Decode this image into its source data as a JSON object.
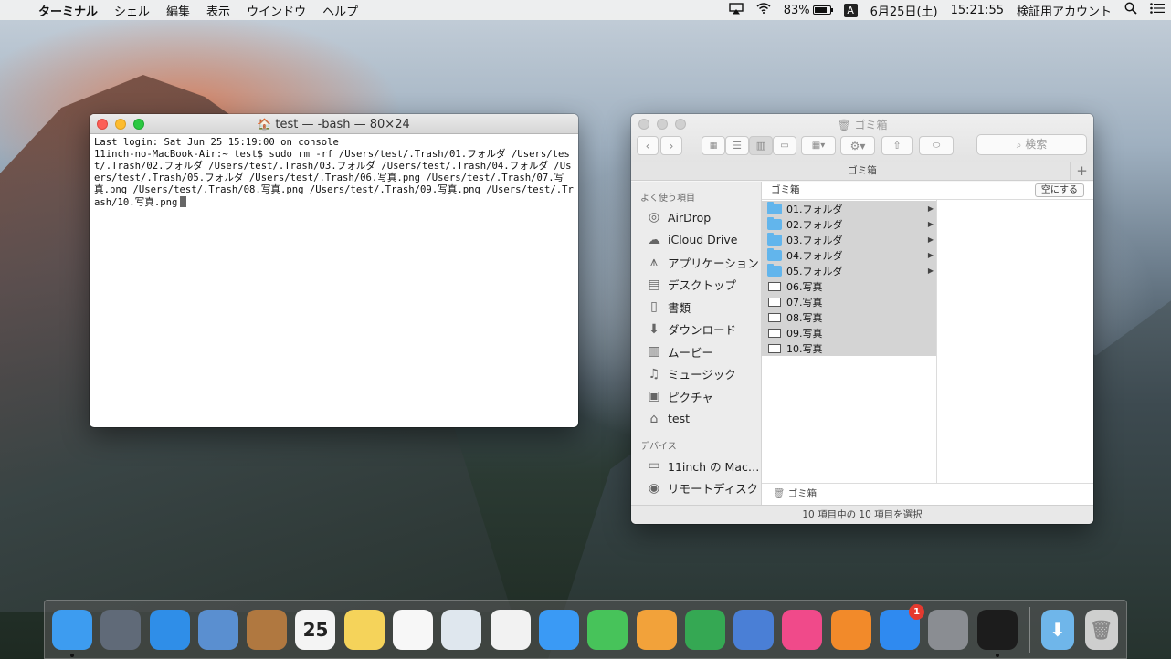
{
  "menubar": {
    "apple": "",
    "app_name": "ターミナル",
    "items": [
      "シェル",
      "編集",
      "表示",
      "ウインドウ",
      "ヘルプ"
    ],
    "battery": "83%",
    "battery_level": 0.83,
    "ime": "A",
    "date": "6月25日(土)",
    "time": "15:21:55",
    "user": "検証用アカウント"
  },
  "terminal": {
    "title": "test — -bash — 80×24",
    "content": "Last login: Sat Jun 25 15:19:00 on console\n11inch-no-MacBook-Air:~ test$ sudo rm -rf /Users/test/.Trash/01.フォルダ /Users/test/.Trash/02.フォルダ /Users/test/.Trash/03.フォルダ /Users/test/.Trash/04.フォルダ /Users/test/.Trash/05.フォルダ /Users/test/.Trash/06.写真.png /Users/test/.Trash/07.写真.png /Users/test/.Trash/08.写真.png /Users/test/.Trash/09.写真.png /Users/test/.Trash/10.写真.png"
  },
  "finder": {
    "title": "ゴミ箱",
    "search_placeholder": "検索",
    "path_tab": "ゴミ箱",
    "favorites_header": "よく使う項目",
    "favorites": [
      {
        "label": "AirDrop",
        "icon": "airdrop-icon"
      },
      {
        "label": "iCloud Drive",
        "icon": "cloud-icon"
      },
      {
        "label": "アプリケーション",
        "icon": "applications-icon"
      },
      {
        "label": "デスクトップ",
        "icon": "desktop-icon"
      },
      {
        "label": "書類",
        "icon": "documents-icon"
      },
      {
        "label": "ダウンロード",
        "icon": "download-icon"
      },
      {
        "label": "ムービー",
        "icon": "movies-icon"
      },
      {
        "label": "ミュージック",
        "icon": "music-icon"
      },
      {
        "label": "ピクチャ",
        "icon": "pictures-icon"
      },
      {
        "label": "test",
        "icon": "home-icon"
      }
    ],
    "devices_header": "デバイス",
    "devices": [
      {
        "label": "11inch の Mac…",
        "icon": "laptop-icon"
      },
      {
        "label": "リモートディスク",
        "icon": "disc-icon"
      }
    ],
    "column_header": "ゴミ箱",
    "empty_button": "空にする",
    "items": [
      {
        "name": "01.フォルダ",
        "type": "folder"
      },
      {
        "name": "02.フォルダ",
        "type": "folder"
      },
      {
        "name": "03.フォルダ",
        "type": "folder"
      },
      {
        "name": "04.フォルダ",
        "type": "folder"
      },
      {
        "name": "05.フォルダ",
        "type": "folder"
      },
      {
        "name": "06.写真",
        "type": "file"
      },
      {
        "name": "07.写真",
        "type": "file"
      },
      {
        "name": "08.写真",
        "type": "file"
      },
      {
        "name": "09.写真",
        "type": "file"
      },
      {
        "name": "10.写真",
        "type": "file"
      }
    ],
    "status_path": "ゴミ箱",
    "bottom_status": "10 項目中の 10 項目を選択"
  },
  "dock": {
    "apps": [
      {
        "name": "finder-icon",
        "color": "#3d9cf0",
        "running": true
      },
      {
        "name": "launchpad-icon",
        "color": "#606a78"
      },
      {
        "name": "safari-icon",
        "color": "#2f8ee8"
      },
      {
        "name": "mail-icon",
        "color": "#5a8fd0"
      },
      {
        "name": "contacts-icon",
        "color": "#b07840"
      },
      {
        "name": "calendar-icon",
        "color": "#f4f4f4",
        "label": "25"
      },
      {
        "name": "notes-icon",
        "color": "#f5d35a"
      },
      {
        "name": "reminders-icon",
        "color": "#f7f7f7"
      },
      {
        "name": "preview-icon",
        "color": "#dfe7ee"
      },
      {
        "name": "photos-icon",
        "color": "#f2f2f2"
      },
      {
        "name": "messages-icon",
        "color": "#3a9af5"
      },
      {
        "name": "facetime-icon",
        "color": "#47c35a"
      },
      {
        "name": "pages-icon",
        "color": "#f2a23a"
      },
      {
        "name": "numbers-icon",
        "color": "#35a853"
      },
      {
        "name": "keynote-icon",
        "color": "#4a7fd6"
      },
      {
        "name": "itunes-icon",
        "color": "#f04a8a"
      },
      {
        "name": "ibooks-icon",
        "color": "#f28a2a"
      },
      {
        "name": "app-store-icon",
        "color": "#2f8af0",
        "badge": "1"
      },
      {
        "name": "system-preferences-icon",
        "color": "#8a8d92"
      },
      {
        "name": "terminal-icon",
        "color": "#1c1c1c",
        "running": true
      }
    ]
  }
}
